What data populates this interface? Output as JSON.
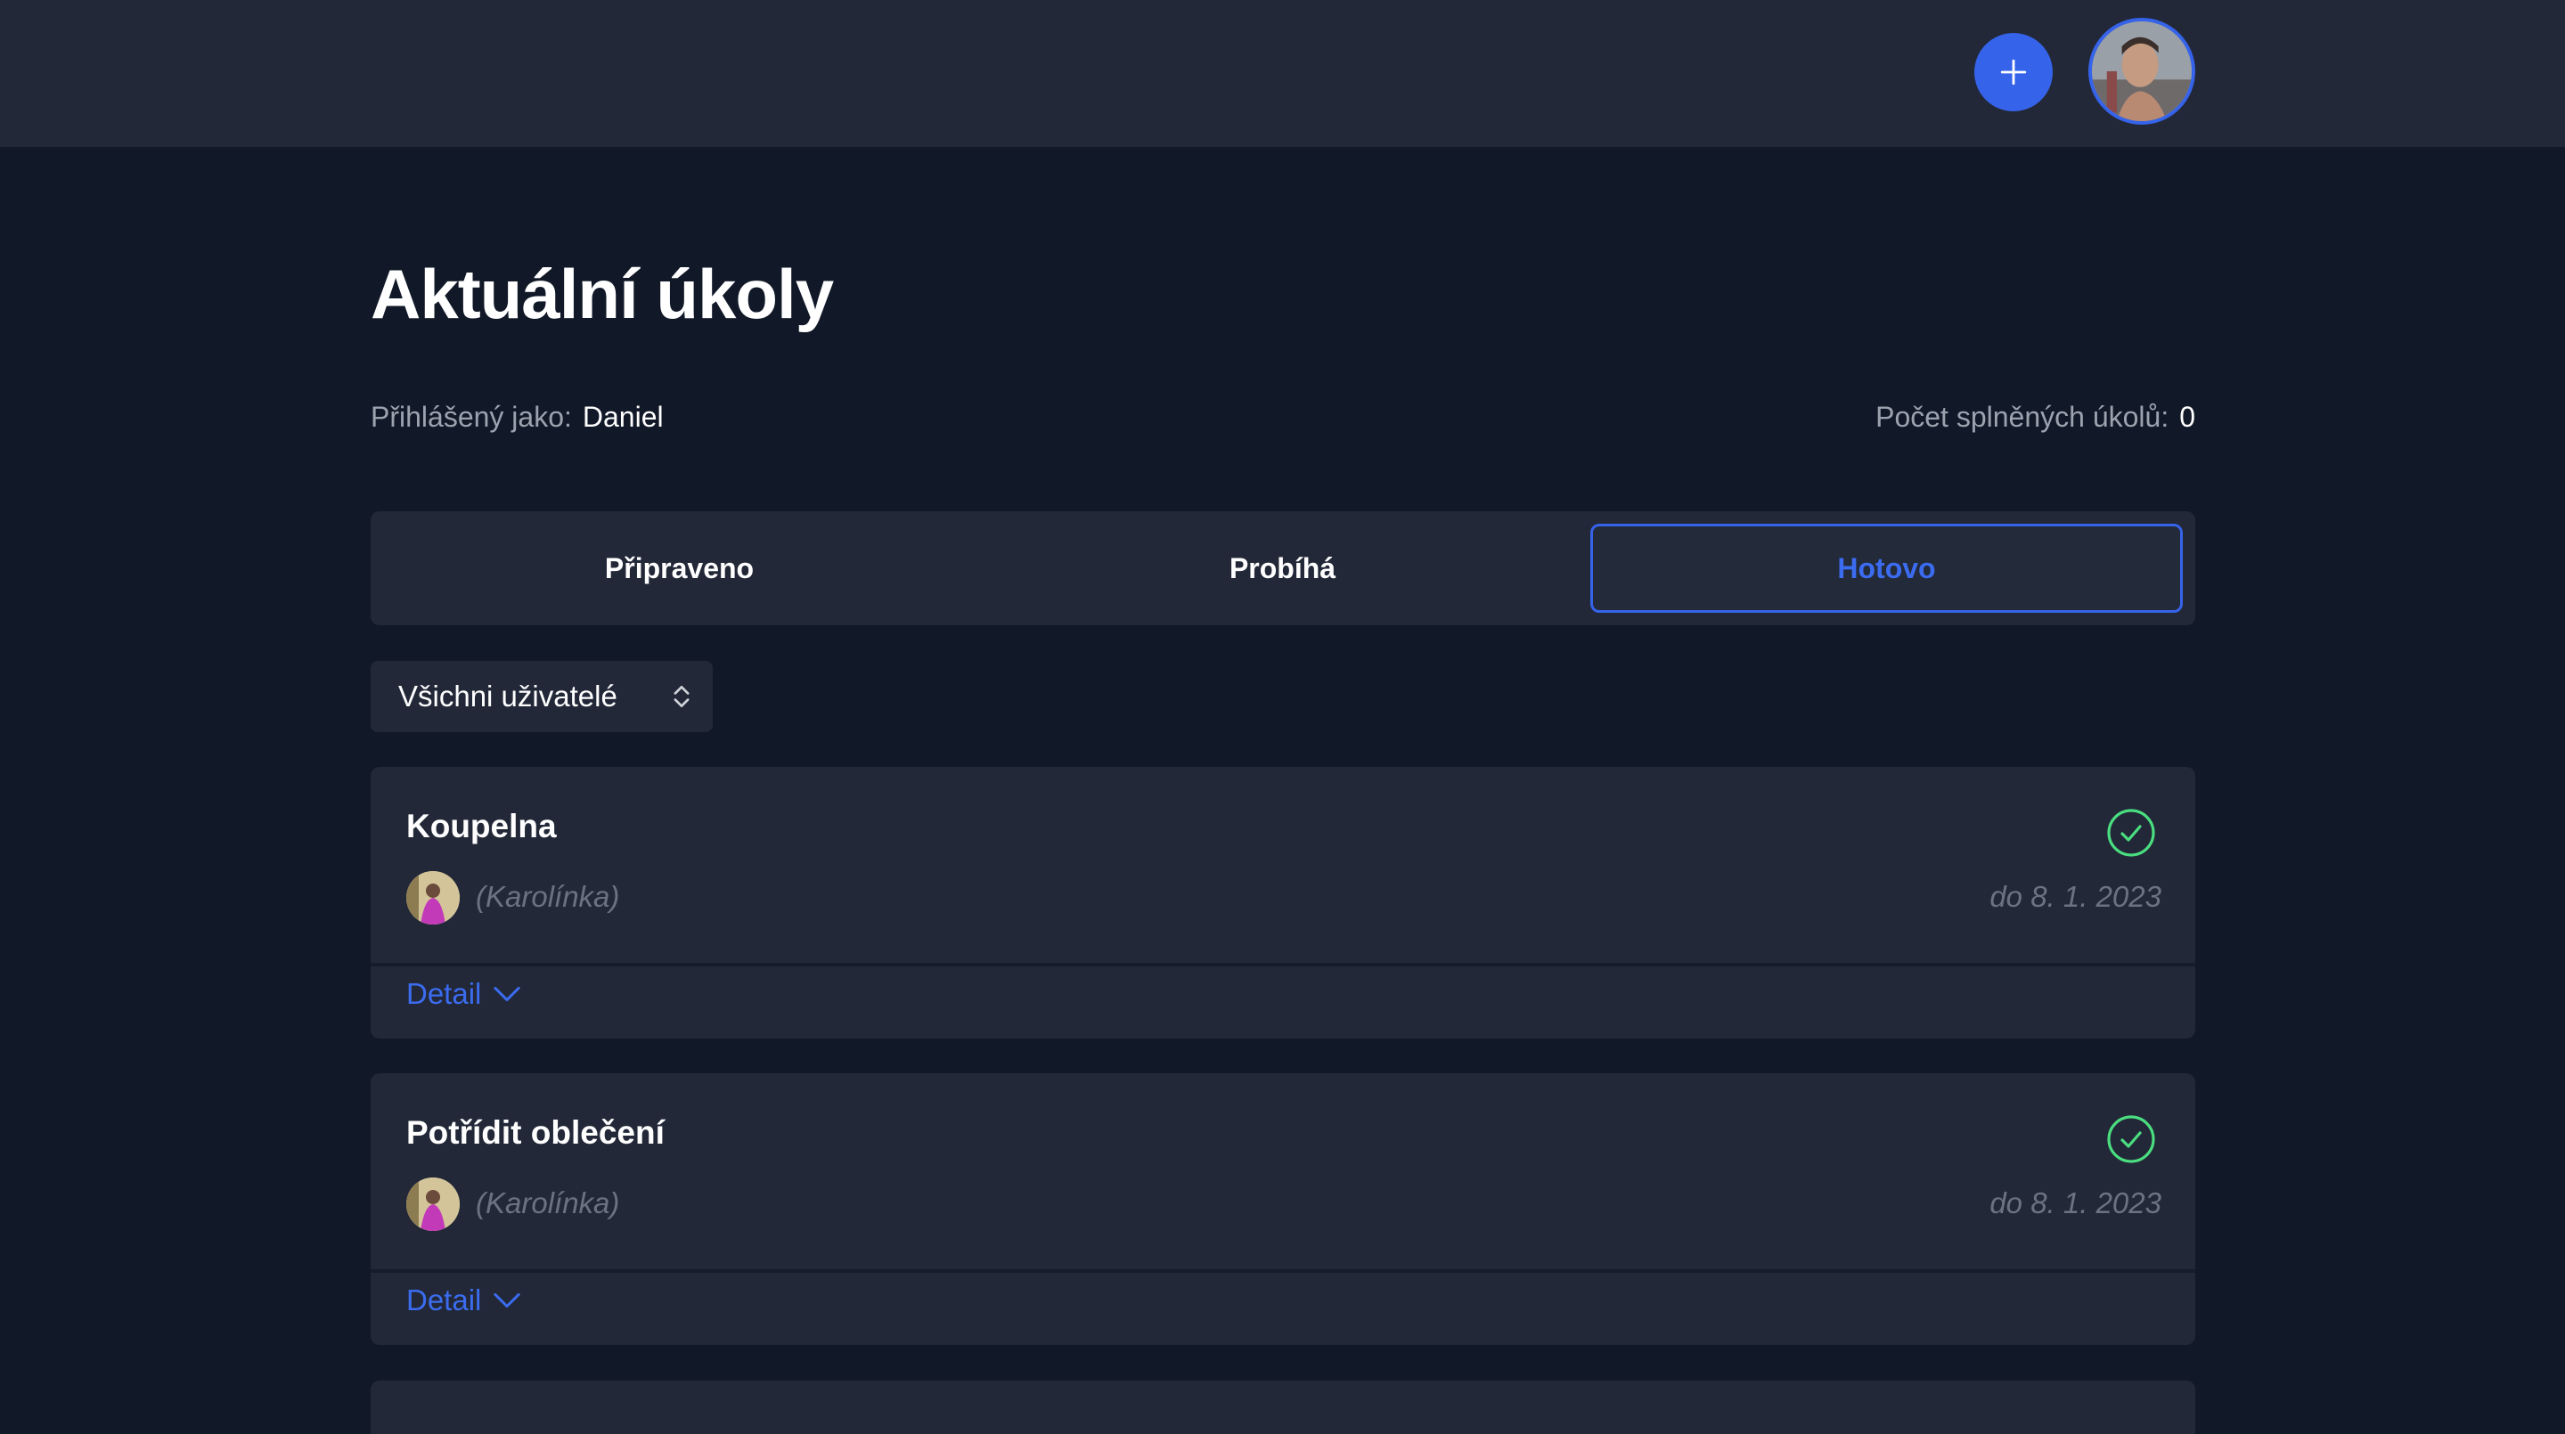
{
  "header": {
    "add_icon": "plus-icon",
    "avatar_icon": "user-avatar"
  },
  "page": {
    "title": "Aktuální úkoly",
    "logged_in_label": "Přihlášený jako:",
    "logged_in_user": "Daniel",
    "completed_label": "Počet splněných úkolů:",
    "completed_count": "0"
  },
  "tabs": [
    {
      "label": "Připraveno",
      "active": false
    },
    {
      "label": "Probíhá",
      "active": false
    },
    {
      "label": "Hotovo",
      "active": true
    }
  ],
  "filter": {
    "selected": "Všichni uživatelé"
  },
  "tasks": [
    {
      "title": "Koupelna",
      "assignee": "(Karolínka)",
      "due": "do 8. 1. 2023",
      "detail_label": "Detail",
      "status_icon": "check-circle-icon"
    },
    {
      "title": "Potřídit oblečení",
      "assignee": "(Karolínka)",
      "due": "do 8. 1. 2023",
      "detail_label": "Detail",
      "status_icon": "check-circle-icon"
    }
  ],
  "colors": {
    "accent": "#3563e9",
    "success": "#4ade80",
    "background": "#111827",
    "surface": "#222838"
  }
}
